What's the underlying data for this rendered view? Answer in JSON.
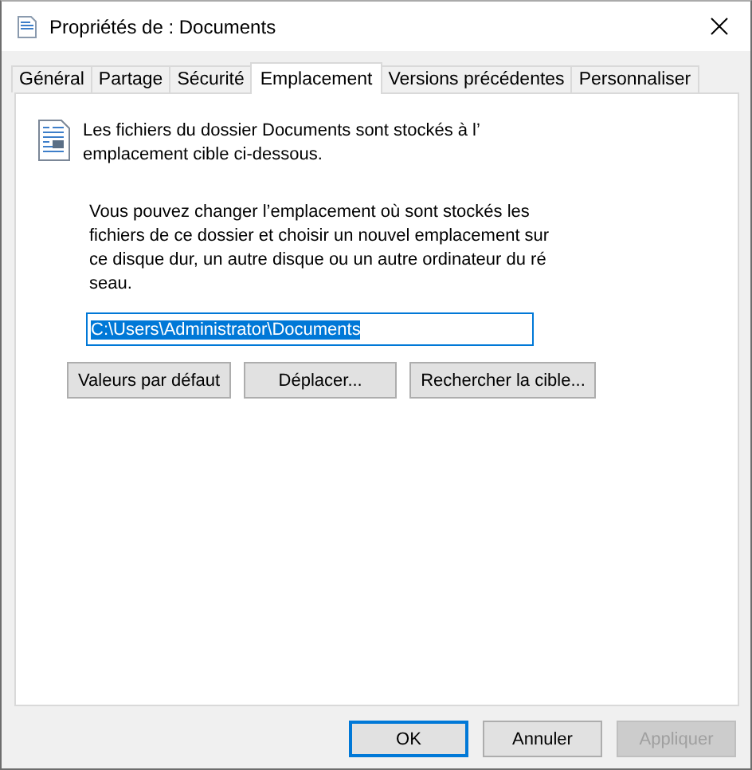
{
  "window": {
    "title": "Propriétés de : Documents"
  },
  "tabs": [
    {
      "label": "Général",
      "selected": false
    },
    {
      "label": "Partage",
      "selected": false
    },
    {
      "label": "Sécurité",
      "selected": false
    },
    {
      "label": "Emplacement",
      "selected": true
    },
    {
      "label": "Versions précédentes",
      "selected": false
    },
    {
      "label": "Personnaliser",
      "selected": false
    }
  ],
  "location": {
    "info": "Les fichiers du dossier Documents sont stockés à l’\nemplacement cible ci-dessous.",
    "description": "Vous pouvez changer l’emplacement où sont stockés les\nfichiers de ce dossier et choisir un nouvel emplacement sur\nce disque dur, un autre disque ou un autre ordinateur du ré\nseau.",
    "path": {
      "value": "C:\\Users\\Administrator\\Documents",
      "selected": true
    },
    "buttons": [
      {
        "label": "Valeurs par défaut",
        "disabled": false
      },
      {
        "label": "Déplacer...",
        "disabled": false
      },
      {
        "label": "Rechercher la cible...",
        "disabled": false
      }
    ]
  },
  "footer_buttons": [
    {
      "label": "OK",
      "default": true,
      "disabled": false
    },
    {
      "label": "Annuler",
      "default": false,
      "disabled": false
    },
    {
      "label": "Appliquer",
      "default": false,
      "disabled": true
    }
  ]
}
